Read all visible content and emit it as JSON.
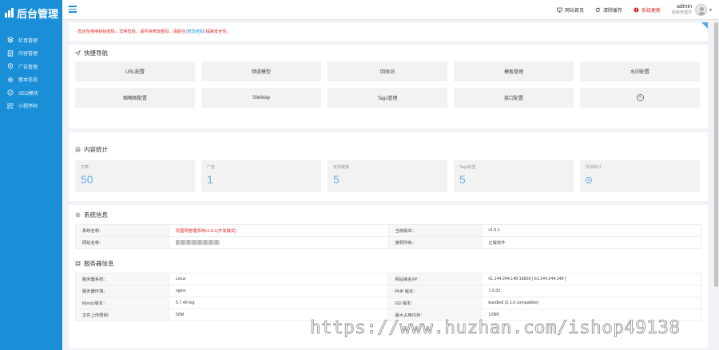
{
  "brand": {
    "title": "后台管理"
  },
  "sidebar": {
    "items": [
      {
        "label": "栏目管理",
        "icon": "layers-icon"
      },
      {
        "label": "内容管理",
        "icon": "document-icon"
      },
      {
        "label": "广告管理",
        "icon": "pin-icon"
      },
      {
        "label": "基本信息",
        "icon": "gear-icon"
      },
      {
        "label": "SEO模块",
        "icon": "target-icon"
      },
      {
        "label": "小程序码",
        "icon": "qrcode-icon"
      }
    ]
  },
  "topbar": {
    "site_home": "网站首页",
    "clear_cache": "清除缓存",
    "system_update": "系统更新",
    "username": "admin",
    "role": "超级管理员"
  },
  "notice": {
    "prefix": "· 您还在使用初始密码，非常危险，请尽快修改密码，请前往",
    "link": "[修改密码]",
    "suffix": "提高安全性。"
  },
  "quick": {
    "title": "快捷导航",
    "buttons": [
      "URL配置",
      "频道模型",
      "回收站",
      "模板管理",
      "水印配置",
      "缩略图配置",
      "SiteMap",
      "Tags管理",
      "接口配置"
    ]
  },
  "stats": {
    "title": "内容统计",
    "cards": [
      {
        "label": "文章",
        "value": "50"
      },
      {
        "label": "广告",
        "value": "1"
      },
      {
        "label": "友情链接",
        "value": "5"
      },
      {
        "label": "Tags标签",
        "value": "5"
      },
      {
        "label": "添加统计",
        "value": ""
      }
    ]
  },
  "system": {
    "title": "系统信息",
    "rows": [
      [
        "系统名称：",
        "优图网管理系统v1.6.1(开发模式)",
        "当前版本：",
        "v1.6.1"
      ],
      [
        "网站名称：",
        "",
        "授权所有：",
        "正版软件"
      ]
    ]
  },
  "server": {
    "title": "服务器信息",
    "rows": [
      [
        "服务器系统：",
        "Linux",
        "网站域名/IP：",
        "61.144.244.148:16803 [ 61.144.244.148 ]"
      ],
      [
        "服务器环境：",
        "nginx",
        "PHP 版本：",
        "7.0.33"
      ],
      [
        "Mysql 版本：",
        "5.7.40-log",
        "GD 版本：",
        "bundled (2.1.0 compatible)"
      ],
      [
        "文件上传限制：",
        "50M",
        "最大占用内存：",
        "128M"
      ]
    ]
  },
  "watermark": "https://www.huzhan.com/ishop49138"
}
